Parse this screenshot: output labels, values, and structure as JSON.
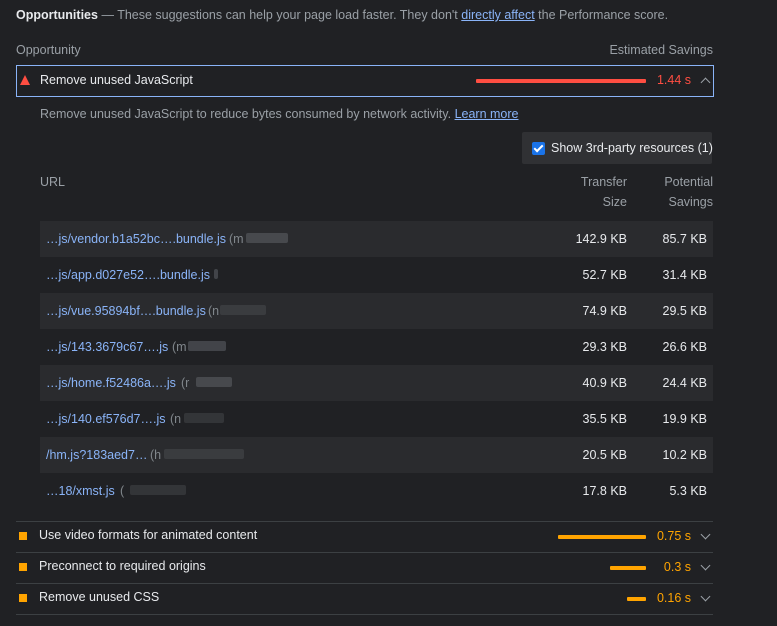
{
  "header": {
    "title": "Opportunities",
    "dash": "—",
    "text_before_link": "These suggestions can help your page load faster. They don't",
    "link": "directly affect",
    "text_after_link": "the Performance score."
  },
  "columns": {
    "opportunity": "Opportunity",
    "estimated_savings": "Estimated Savings"
  },
  "colors": {
    "fail": "#ff4e42",
    "average": "#ffa400",
    "link": "#8ab4f8",
    "background": "#202124"
  },
  "expanded_audit": {
    "icon": "red-triangle-icon",
    "title": "Remove unused JavaScript",
    "savings": "1.44 s",
    "savings_fraction": 1.0,
    "description": "Remove unused JavaScript to reduce bytes consumed by network activity.",
    "learn_more": "Learn more",
    "third_party_checked": true,
    "third_party_label": "Show 3rd-party resources (1)",
    "table_headers": {
      "url": "URL",
      "transfer_line1": "Transfer",
      "transfer_line2": "Size",
      "potential_line1": "Potential",
      "potential_line2": "Savings"
    },
    "rows": [
      {
        "url": "…js/vendor.b1a52bc….bundle.js",
        "host": "(m",
        "transfer": "142.9 KB",
        "savings": "85.7 KB"
      },
      {
        "url": "…js/app.d027e52….bundle.js",
        "host": "",
        "transfer": "52.7 KB",
        "savings": "31.4 KB"
      },
      {
        "url": "…js/vue.95894bf….bundle.js",
        "host": "(n",
        "transfer": "74.9 KB",
        "savings": "29.5 KB"
      },
      {
        "url": "…js/143.3679c67….js",
        "host": "(m",
        "transfer": "29.3 KB",
        "savings": "26.6 KB"
      },
      {
        "url": "…js/home.f52486a….js",
        "host": "(r",
        "transfer": "40.9 KB",
        "savings": "24.4 KB"
      },
      {
        "url": "…js/140.ef576d7….js",
        "host": "(n",
        "transfer": "35.5 KB",
        "savings": "19.9 KB"
      },
      {
        "url": "/hm.js?183aed7…",
        "host": "(h",
        "transfer": "20.5 KB",
        "savings": "10.2 KB"
      },
      {
        "url": "…18/xmst.js",
        "host": "(",
        "transfer": "17.8 KB",
        "savings": "5.3 KB"
      }
    ]
  },
  "collapsed_audits": [
    {
      "icon": "orange-square-icon",
      "title": "Use video formats for animated content",
      "savings": "0.75 s",
      "savings_fraction": 0.52
    },
    {
      "icon": "orange-square-icon",
      "title": "Preconnect to required origins",
      "savings": "0.3 s",
      "savings_fraction": 0.21
    },
    {
      "icon": "orange-square-icon",
      "title": "Remove unused CSS",
      "savings": "0.16 s",
      "savings_fraction": 0.11
    }
  ]
}
